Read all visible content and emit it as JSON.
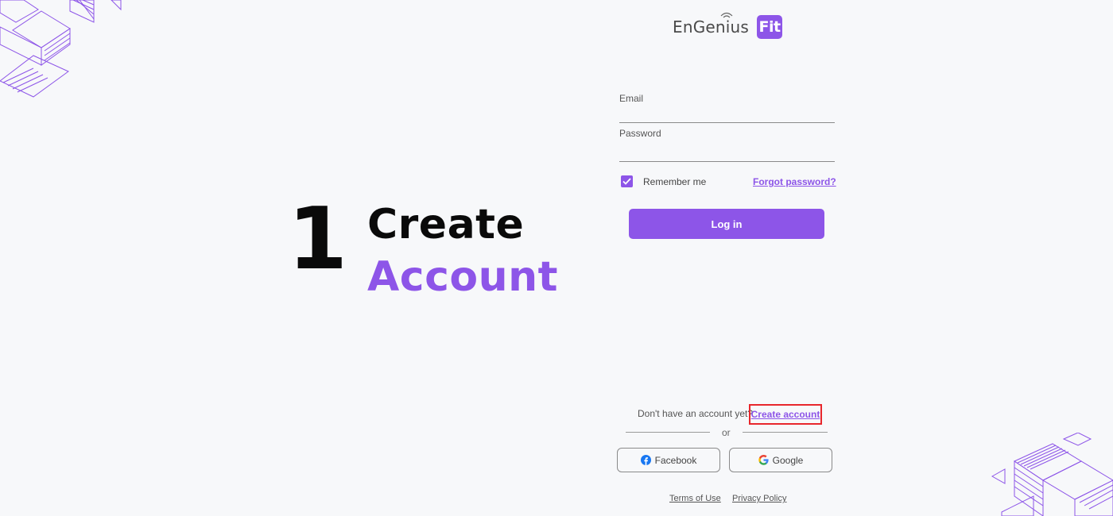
{
  "step": {
    "number": "1",
    "title_line1": "Create",
    "title_line2": "Account"
  },
  "logo": {
    "brand": "EnGenius",
    "product": "Fit"
  },
  "form": {
    "email_label": "Email",
    "email_value": "",
    "password_label": "Password",
    "password_value": "",
    "remember_label": "Remember me",
    "remember_checked": true,
    "forgot_label": "Forgot password?",
    "login_label": "Log in"
  },
  "signup": {
    "prompt": "Don't have an account yet?",
    "create_label": "Create account",
    "or_label": "or"
  },
  "social": {
    "facebook_label": "Facebook",
    "google_label": "Google"
  },
  "footer": {
    "terms_label": "Terms of Use",
    "privacy_label": "Privacy Policy"
  },
  "colors": {
    "accent": "#8d55e8",
    "highlight": "#e8272c",
    "background": "#f7f8fa"
  }
}
